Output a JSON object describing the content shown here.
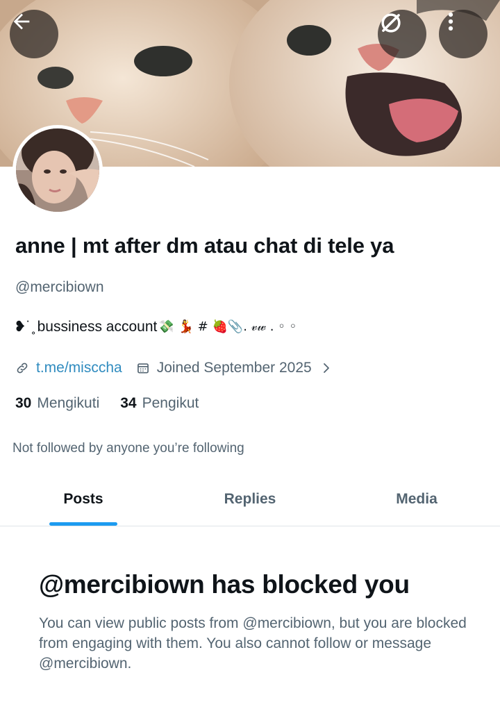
{
  "header": {
    "back_icon": "arrow-left-icon",
    "nosync_icon": "no-sync-icon",
    "more_icon": "more-vertical-icon"
  },
  "profile": {
    "display_name": "anne | mt after dm atau chat di tele ya",
    "handle": "@mercibiown",
    "bio_prefix": "❥˙˳",
    "bio_text": "bussiness account",
    "bio_emojis": "💸 💃 # 🍓📎. 𝓋𝓌 . ◦ ◦",
    "link": "t.me/misccha",
    "joined": "Joined September 2025",
    "following_count": "30",
    "following_label": "Mengikuti",
    "followers_count": "34",
    "followers_label": "Pengikut",
    "not_followed_text": "Not followed by anyone you’re following"
  },
  "tabs": [
    {
      "label": "Posts",
      "active": true
    },
    {
      "label": "Replies",
      "active": false
    },
    {
      "label": "Media",
      "active": false
    }
  ],
  "blocked": {
    "title": "@mercibiown has blocked you",
    "description": "You can view public posts from @mercibiown, but you are blocked from engaging with them. You also cannot follow or message @mercibiown."
  },
  "colors": {
    "accent": "#1d9bf0",
    "text_primary": "#0f1419",
    "text_secondary": "#536471"
  }
}
